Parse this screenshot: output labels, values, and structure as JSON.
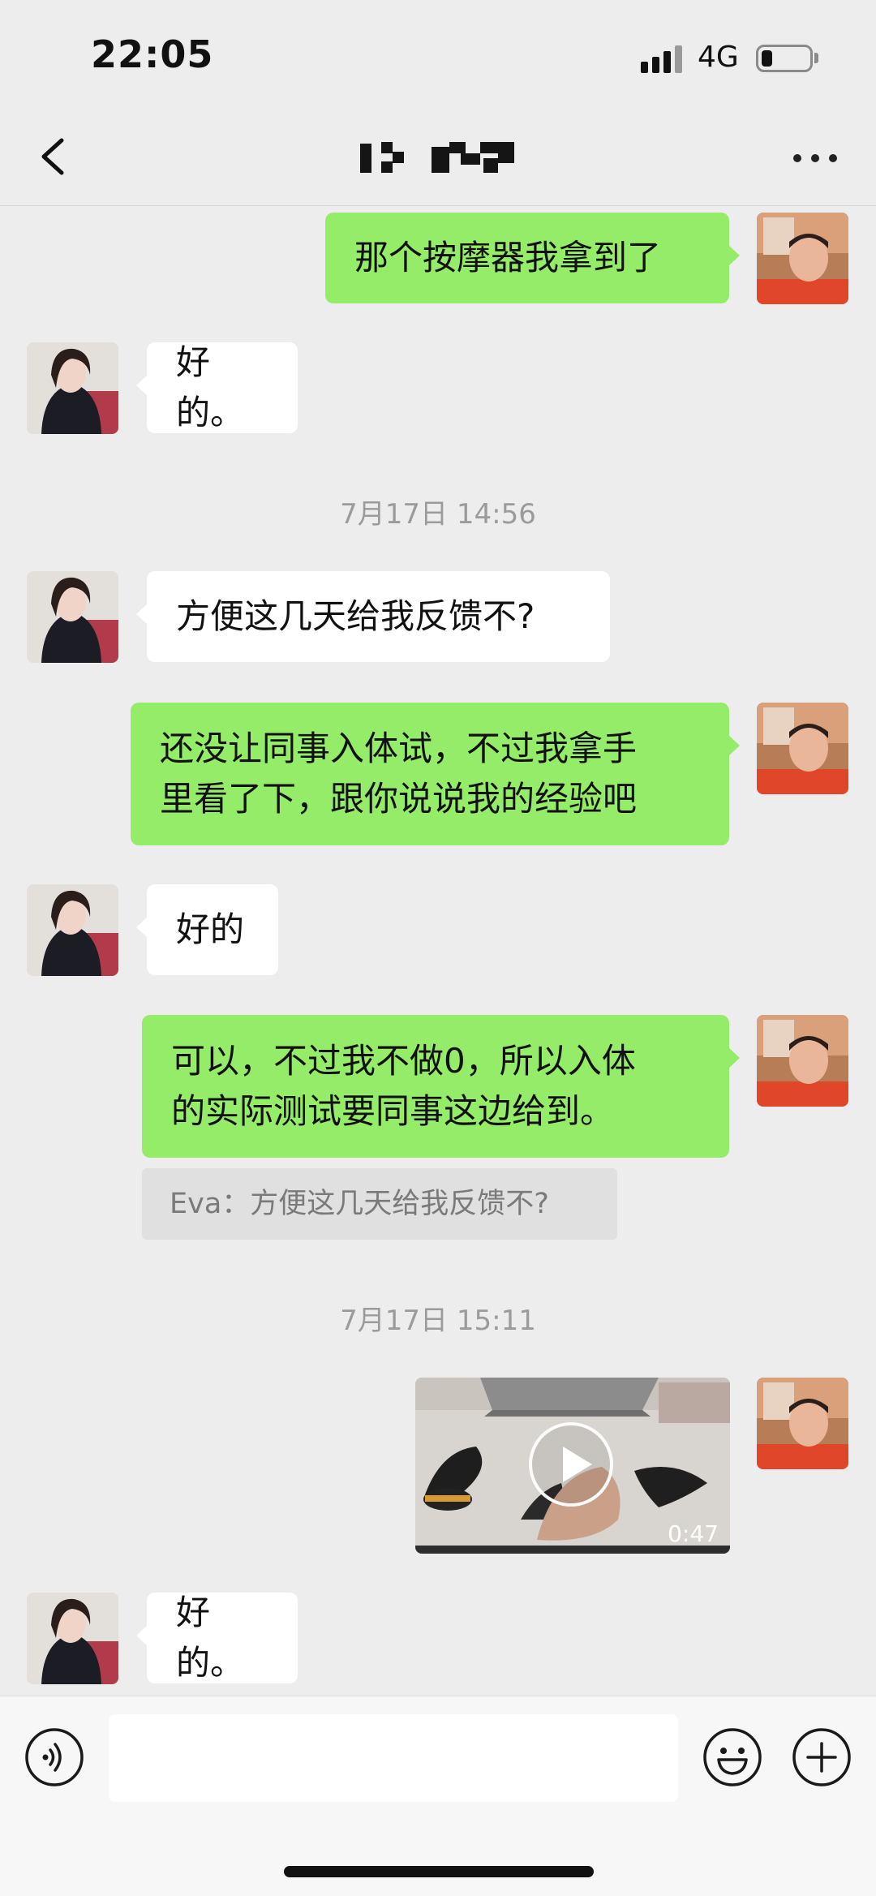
{
  "status_bar": {
    "time": "22:05",
    "network": "4G"
  },
  "header": {
    "title_obscured": true
  },
  "messages": [
    {
      "sender": "me",
      "text": "那个按摩器我拿到了"
    },
    {
      "sender": "other",
      "text": "好的。"
    },
    {
      "type": "time",
      "text": "7月17日 14:56"
    },
    {
      "sender": "other",
      "text": "方便这几天给我反馈不?"
    },
    {
      "sender": "me",
      "lines": [
        "还没让同事入体试，不过我拿手",
        "里看了下，跟你说说我的经验吧"
      ]
    },
    {
      "sender": "other",
      "text": "好的"
    },
    {
      "sender": "me",
      "lines": [
        "可以，不过我不做0，所以入体",
        "的实际测试要同事这边给到。"
      ],
      "quote": "Eva：方便这几天给我反馈不?"
    },
    {
      "type": "time",
      "text": "7月17日 15:11"
    },
    {
      "sender": "me",
      "type": "video",
      "duration": "0:47"
    },
    {
      "sender": "other",
      "text": "好的。"
    }
  ],
  "input_bar": {
    "placeholder": ""
  },
  "icons": {
    "back": "chevron-left-icon",
    "more": "more-dots-icon",
    "voice": "voice-icon",
    "emoji": "emoji-icon",
    "plus": "plus-icon",
    "play": "play-icon"
  },
  "colors": {
    "background": "#ededed",
    "my_bubble": "#95ec69",
    "other_bubble": "#ffffff",
    "timestamp_text": "#9b9b9b"
  }
}
